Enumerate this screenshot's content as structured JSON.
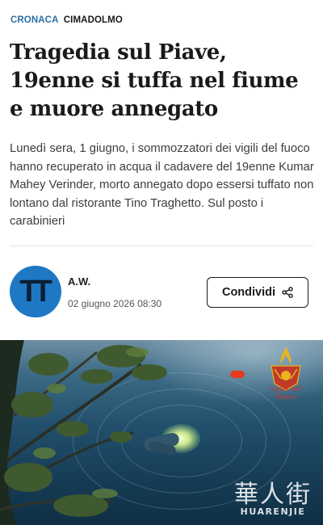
{
  "kicker": {
    "section": "CRONACA",
    "place": "CIMADOLMO"
  },
  "article": {
    "headline": "Tragedia sul Piave, 19enne si tuffa nel fiume e muore annegato",
    "summary": "Lunedì sera, 1 giugno, i sommozzatori dei vigili del fuoco hanno recuperato in acqua il cadavere del 19enne Kumar Mahey Verinder, morto annegato dopo essersi tuffato non lontano dal ristorante Tino Traghetto. Sul posto i carabinieri"
  },
  "byline": {
    "avatar_text": "TT",
    "author": "A.W.",
    "date": "02 giugno 2026 08:30"
  },
  "share": {
    "label": "Condividi",
    "icon": "share-icon"
  },
  "photo": {
    "logo_text": "Vigili del Fuoco",
    "watermark_cn": "華人街",
    "watermark_en": "HUARENJIE"
  },
  "colors": {
    "accent": "#2c6fa6",
    "avatar_bg": "#1f78c4",
    "vvf_red": "#d9302a"
  }
}
